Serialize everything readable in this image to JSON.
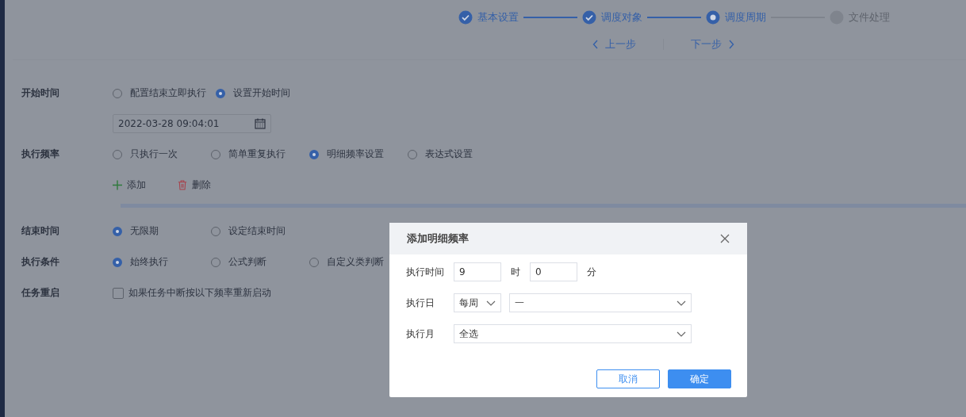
{
  "steps": [
    {
      "label": "基本设置",
      "completed": true,
      "selected": false
    },
    {
      "label": "调度对象",
      "completed": true,
      "selected": false
    },
    {
      "label": "调度周期",
      "completed": false,
      "selected": true
    },
    {
      "label": "文件处理",
      "completed": false,
      "selected": false
    }
  ],
  "nav": {
    "prev": "上一步",
    "next": "下一步"
  },
  "form": {
    "rows": [
      {
        "kind": "radio",
        "label": "开始时间",
        "options": [
          {
            "label": "配置结束立即执行",
            "selected": false
          },
          {
            "label": "设置开始时间",
            "selected": true
          }
        ]
      },
      {
        "kind": "date",
        "value": "2022-03-28 09:04:01"
      },
      {
        "kind": "radio",
        "label": "执行频率",
        "options": [
          {
            "label": "只执行一次",
            "selected": false
          },
          {
            "label": "简单重复执行",
            "selected": false
          },
          {
            "label": "明细频率设置",
            "selected": true
          },
          {
            "label": "表达式设置",
            "selected": false
          }
        ]
      },
      {
        "kind": "actions",
        "add": "添加",
        "remove": "删除"
      },
      {
        "kind": "divider"
      },
      {
        "kind": "radio",
        "label": "结束时间",
        "options": [
          {
            "label": "无限期",
            "selected": true
          },
          {
            "label": "设定结束时间",
            "selected": false
          }
        ]
      },
      {
        "kind": "radio",
        "label": "执行条件",
        "options": [
          {
            "label": "始终执行",
            "selected": true
          },
          {
            "label": "公式判断",
            "selected": false
          },
          {
            "label": "自定义类判断",
            "selected": false
          }
        ]
      },
      {
        "kind": "checkbox",
        "label": "任务重启",
        "text": "如果任务中断按以下频率重新启动",
        "checked": false
      }
    ]
  },
  "dialog": {
    "title": "添加明细频率",
    "time": {
      "label": "执行时间",
      "hour": "9",
      "hour_unit": "时",
      "minute": "0",
      "minute_unit": "分"
    },
    "day": {
      "label": "执行日",
      "period": "每周",
      "weekday": "一"
    },
    "month": {
      "label": "执行月",
      "value": "全选"
    },
    "cancel": "取消",
    "ok": "确定"
  }
}
